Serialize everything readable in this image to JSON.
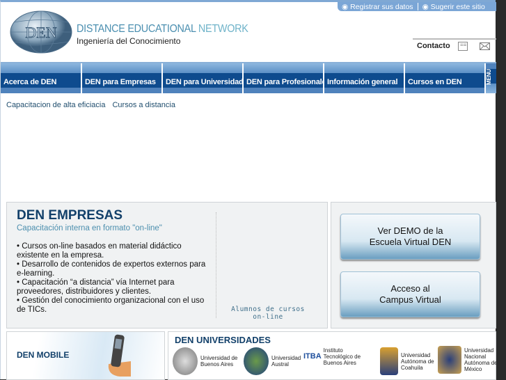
{
  "top_links": [
    "Registrar sus datos",
    "Sugerir este sitio"
  ],
  "header": {
    "title_part1": "DISTANCE ",
    "title_part2": "EDUCATIONAL ",
    "title_part3": "NETWORK",
    "subtitle": "Ingeniería del Conocimiento",
    "logo_text": "DEN",
    "contact": "Contacto"
  },
  "nav": {
    "items": [
      "Acerca de DEN",
      "DEN para Empresas",
      "DEN para Universidades",
      "DEN para Profesionales",
      "Información general",
      "Cursos en DEN"
    ],
    "menu": "MENU"
  },
  "breadcrumbs": [
    "Capacitacion de alta eficiacia",
    "Cursos a distancia"
  ],
  "empresas": {
    "title": "DEN EMPRESAS",
    "subtitle": "Capacitación interna en formato \"on-line\"",
    "bullets": [
      "• Cursos on-line basados en material didáctico existente en la empresa.",
      "• Desarrollo de contenidos de expertos externos para e-learning.",
      "• Capacitación “a distancia” vía Internet para proveedores, distribuidores y clientes.",
      "• Gestión del conocimiento organizacional con el uso de TICs."
    ],
    "alumnos": "Alumnos de cursos on-line"
  },
  "buttons": {
    "demo": "Ver DEMO de la Escuela Virtual DEN",
    "campus": "Acceso al Campus Virtual"
  },
  "mobile": {
    "label": "DEN MOBILE"
  },
  "universidades": {
    "title": "DEN UNIVERSIDADES",
    "items": [
      "Universidad de Buenos Aires",
      "Universidad Austral",
      "Instituto Tecnológico de Buenos Aires",
      "Universidad Autónoma de Coahuila",
      "Universidad Nacional Autónoma de México"
    ],
    "itba": "ITBA"
  }
}
